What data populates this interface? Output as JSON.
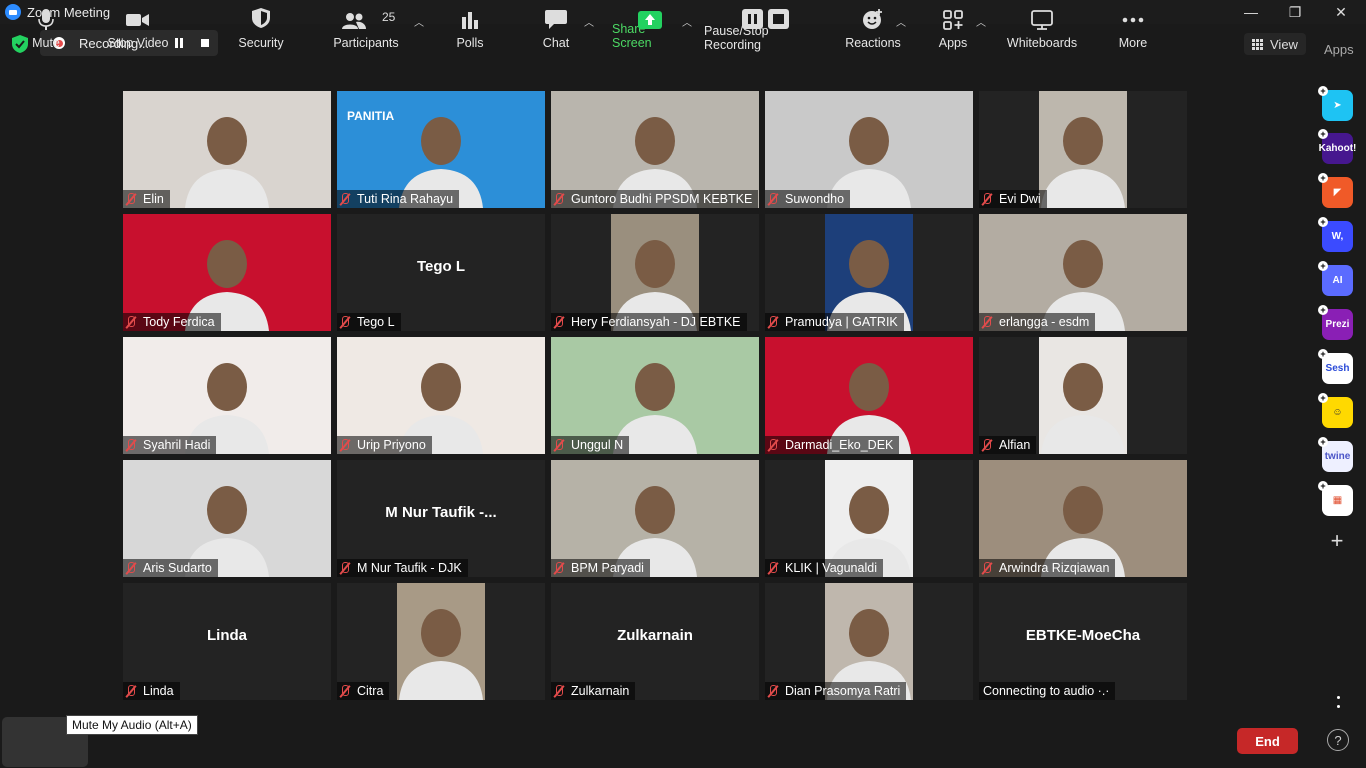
{
  "window": {
    "title": "Zoom Meeting",
    "minimize": "—",
    "restore": "❐",
    "close": "✕"
  },
  "topbar": {
    "recording_label": "Recording...",
    "view_label": "View",
    "apps_label": "Apps"
  },
  "tiles": [
    {
      "name": "Elin",
      "bg": "#d9d4cf",
      "mode": "video"
    },
    {
      "name": "Tuti Rina Rahayu",
      "bg": "#2c8fd8",
      "mode": "video",
      "banner": "PANITIA"
    },
    {
      "name": "Guntoro Budhi PPSDM KEBTKE",
      "bg": "#b9b5ad",
      "mode": "video",
      "active": true
    },
    {
      "name": "Suwondho",
      "bg": "#c9c9c9",
      "mode": "video"
    },
    {
      "name": "Evi Dwi",
      "bg": "#bdb7ad",
      "mode": "narrow"
    },
    {
      "name": "Tody Ferdica",
      "bg": "#c8102e",
      "mode": "video"
    },
    {
      "name": "Tego L",
      "mode": "name",
      "display": "Tego L"
    },
    {
      "name": "Hery Ferdiansyah - DJ EBTKE",
      "bg": "#9a8f7e",
      "mode": "narrow"
    },
    {
      "name": "Pramudya | GATRIK",
      "bg": "#1d3f7a",
      "mode": "narrow"
    },
    {
      "name": "erlangga - esdm",
      "bg": "#b3aca2",
      "mode": "video"
    },
    {
      "name": "Syahril Hadi",
      "bg": "#f1ecea",
      "mode": "video"
    },
    {
      "name": "Urip Priyono",
      "bg": "#efe9e4",
      "mode": "video"
    },
    {
      "name": "Unggul N",
      "bg": "#a9c9a4",
      "mode": "video"
    },
    {
      "name": "Darmadi_Eko_DEK",
      "bg": "#c8102e",
      "mode": "video"
    },
    {
      "name": "Alfian",
      "bg": "#e9e6e3",
      "mode": "narrow"
    },
    {
      "name": "Aris Sudarto",
      "bg": "#d8d8d8",
      "mode": "video"
    },
    {
      "name": "M Nur Taufik - DJK",
      "mode": "name",
      "display": "M Nur Taufik -..."
    },
    {
      "name": "BPM Paryadi",
      "bg": "#b6b2a7",
      "mode": "video"
    },
    {
      "name": "KLIK | Vagunaldi",
      "bg": "#eeeeee",
      "mode": "narrow"
    },
    {
      "name": "Arwindra Rizqiawan",
      "bg": "#9d8e7d",
      "mode": "video"
    },
    {
      "name": "Linda",
      "mode": "name",
      "display": "Linda"
    },
    {
      "name": "Citra",
      "bg": "#a89a86",
      "mode": "narrow"
    },
    {
      "name": "Zulkarnain",
      "mode": "name",
      "display": "Zulkarnain"
    },
    {
      "name": "Dian Prasomya Ratri",
      "bg": "#bfb7ad",
      "mode": "narrow"
    },
    {
      "name": "Connecting to audio ·.·",
      "mode": "name",
      "display": "EBTKE-MoeCha",
      "unmuted": true
    }
  ],
  "apps_rail": [
    {
      "name": "app-1",
      "color": "#1ec3f3",
      "text": "➤"
    },
    {
      "name": "kahoot",
      "color": "#46178f",
      "text": "Kahoot!"
    },
    {
      "name": "app-3",
      "color": "#f05a28",
      "text": "◤"
    },
    {
      "name": "wooclap",
      "color": "#3b4bff",
      "text": "W,"
    },
    {
      "name": "ai-app",
      "color": "#5b6bff",
      "text": "AI"
    },
    {
      "name": "prezi",
      "color": "#8a1fb5",
      "text": "Prezi"
    },
    {
      "name": "sesh",
      "color": "#ffffff",
      "text": "Sesh",
      "textColor": "#2b4bd8"
    },
    {
      "name": "emoji-app",
      "color": "#ffd900",
      "text": "☺",
      "textColor": "#333"
    },
    {
      "name": "twine",
      "color": "#eef0ff",
      "text": "twine",
      "textColor": "#4b55c8"
    },
    {
      "name": "more-apps",
      "color": "#ffffff",
      "text": "▦",
      "textColor": "#e04b2b"
    }
  ],
  "toolbar": {
    "mute": "Mute",
    "mute_tooltip": "Mute My Audio (Alt+A)",
    "stop_video": "Stop Video",
    "security": "Security",
    "participants": "Participants",
    "participants_count": "25",
    "polls": "Polls",
    "chat": "Chat",
    "share_screen": "Share Screen",
    "pause_stop_recording": "Pause/Stop Recording",
    "reactions": "Reactions",
    "apps": "Apps",
    "whiteboards": "Whiteboards",
    "more": "More",
    "end": "End",
    "help": "?"
  }
}
